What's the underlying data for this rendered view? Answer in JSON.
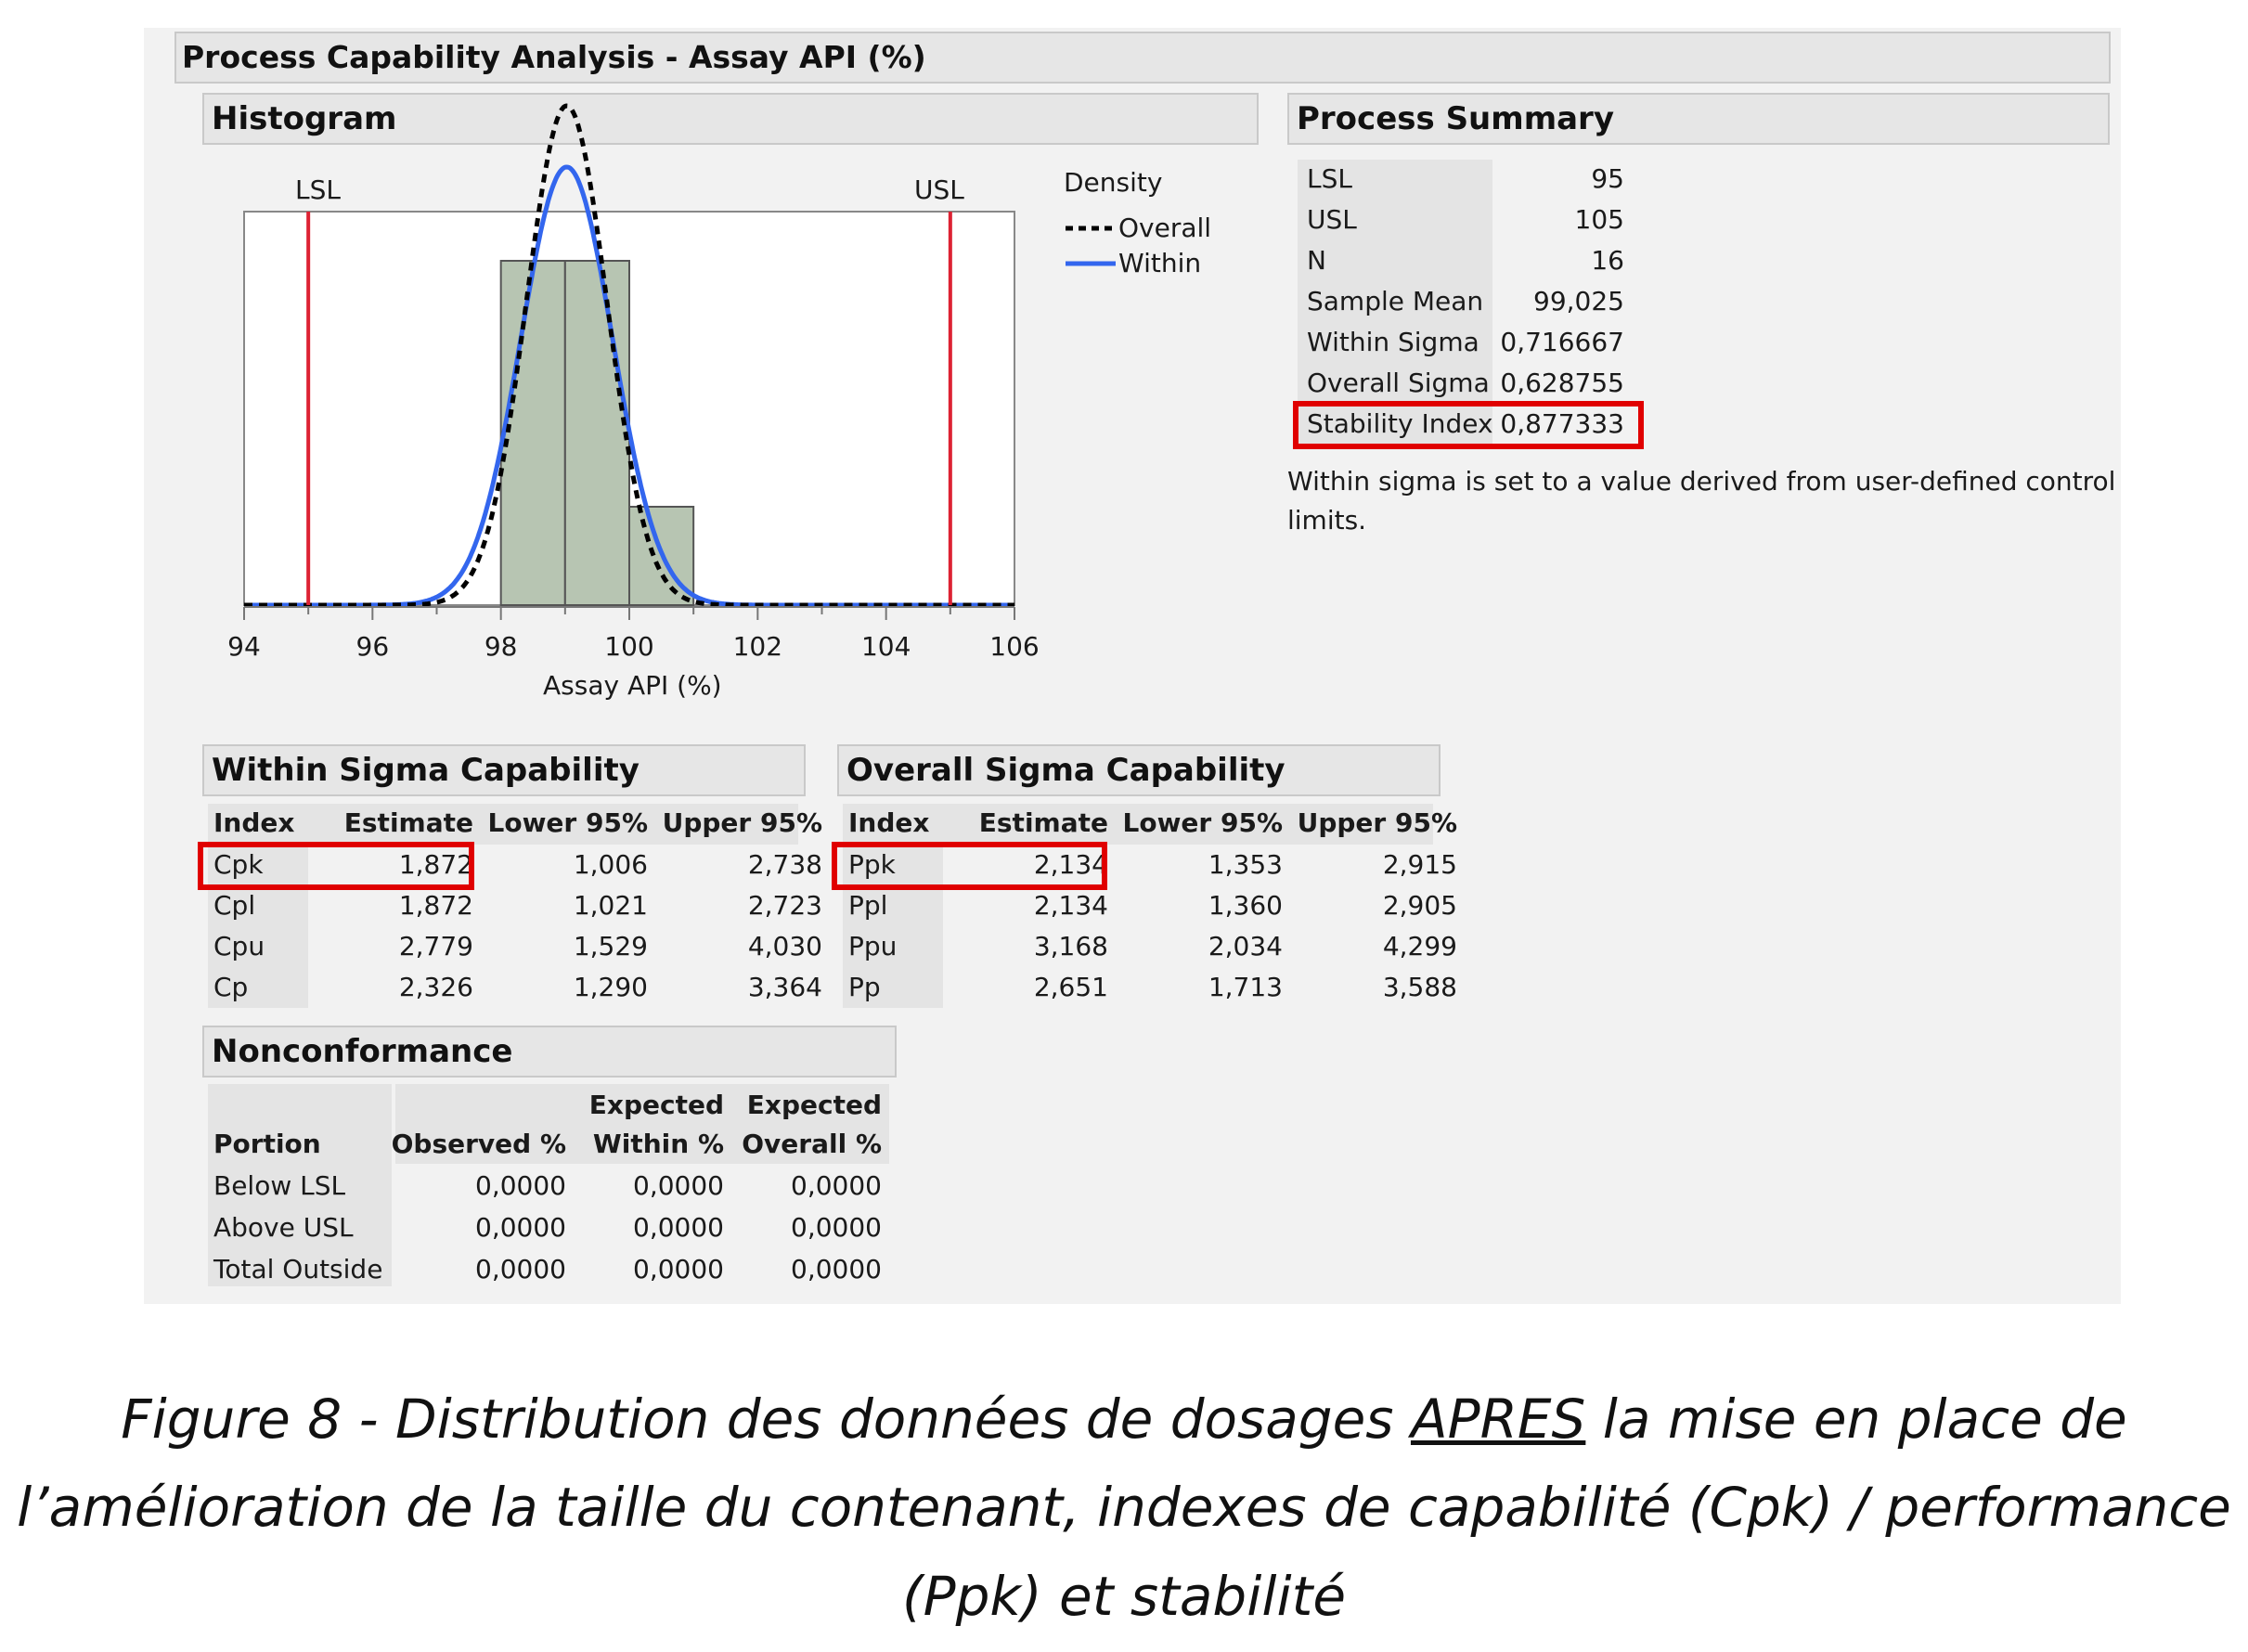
{
  "title": "Process Capability Analysis - Assay API (%)",
  "histogram": {
    "header": "Histogram",
    "lsl_label": "LSL",
    "usl_label": "USL",
    "xlabel": "Assay API (%)",
    "legend_title": "Density",
    "legend_overall": "Overall",
    "legend_within": "Within"
  },
  "chart_data": {
    "type": "bar",
    "title": "",
    "xlabel": "Assay API (%)",
    "ylabel": "",
    "xlim": [
      94,
      106
    ],
    "xticks": [
      "94",
      "96",
      "98",
      "100",
      "102",
      "104",
      "106"
    ],
    "bins": [
      {
        "from": 98,
        "to": 99,
        "count": 7
      },
      {
        "from": 99,
        "to": 100,
        "count": 7
      },
      {
        "from": 100,
        "to": 101,
        "count": 2
      }
    ],
    "spec_limits": {
      "LSL": 95,
      "USL": 105
    },
    "series": [
      {
        "name": "Overall",
        "mean": 99.025,
        "sigma": 0.628755,
        "style": "dashed",
        "color": "#000000"
      },
      {
        "name": "Within",
        "mean": 99.025,
        "sigma": 0.716667,
        "style": "solid",
        "color": "#3366ee"
      }
    ],
    "colors": {
      "bars": "#b7c5b2",
      "spec_lines": "#dd2233"
    }
  },
  "process_summary": {
    "header": "Process Summary",
    "rows": [
      {
        "label": "LSL",
        "value": "95"
      },
      {
        "label": "USL",
        "value": "105"
      },
      {
        "label": "N",
        "value": "16"
      },
      {
        "label": "Sample Mean",
        "value": "99,025"
      },
      {
        "label": "Within Sigma",
        "value": "0,716667"
      },
      {
        "label": "Overall Sigma",
        "value": "0,628755"
      },
      {
        "label": "Stability Index",
        "value": "0,877333"
      }
    ],
    "note_line1": "Within sigma is set to a value derived from user-defined control",
    "note_line2": "limits."
  },
  "within": {
    "header": "Within Sigma Capability",
    "columns": [
      "Index",
      "Estimate",
      "Lower 95%",
      "Upper 95%"
    ],
    "rows": [
      [
        "Cpk",
        "1,872",
        "1,006",
        "2,738"
      ],
      [
        "Cpl",
        "1,872",
        "1,021",
        "2,723"
      ],
      [
        "Cpu",
        "2,779",
        "1,529",
        "4,030"
      ],
      [
        "Cp",
        "2,326",
        "1,290",
        "3,364"
      ]
    ]
  },
  "overall": {
    "header": "Overall Sigma Capability",
    "columns": [
      "Index",
      "Estimate",
      "Lower 95%",
      "Upper 95%"
    ],
    "rows": [
      [
        "Ppk",
        "2,134",
        "1,353",
        "2,915"
      ],
      [
        "Ppl",
        "2,134",
        "1,360",
        "2,905"
      ],
      [
        "Ppu",
        "3,168",
        "2,034",
        "4,299"
      ],
      [
        "Pp",
        "2,651",
        "1,713",
        "3,588"
      ]
    ]
  },
  "nonconformance": {
    "header": "Nonconformance",
    "col_portion": "Portion",
    "col_observed": "Observed %",
    "col_exp_within_1": "Expected",
    "col_exp_within_2": "Within %",
    "col_exp_overall_1": "Expected",
    "col_exp_overall_2": "Overall %",
    "rows": [
      [
        "Below LSL",
        "0,0000",
        "0,0000",
        "0,0000"
      ],
      [
        "Above USL",
        "0,0000",
        "0,0000",
        "0,0000"
      ],
      [
        "Total Outside",
        "0,0000",
        "0,0000",
        "0,0000"
      ]
    ]
  },
  "caption": {
    "line1_a": "Figure 8 - Distribution des données de dosages ",
    "line1_u": "APRES",
    "line1_b": " la mise en place de",
    "line2": "l’amélioration de la taille du contenant, indexes de capabilité (Cpk) / performance",
    "line3": "(Ppk) et stabilité"
  }
}
